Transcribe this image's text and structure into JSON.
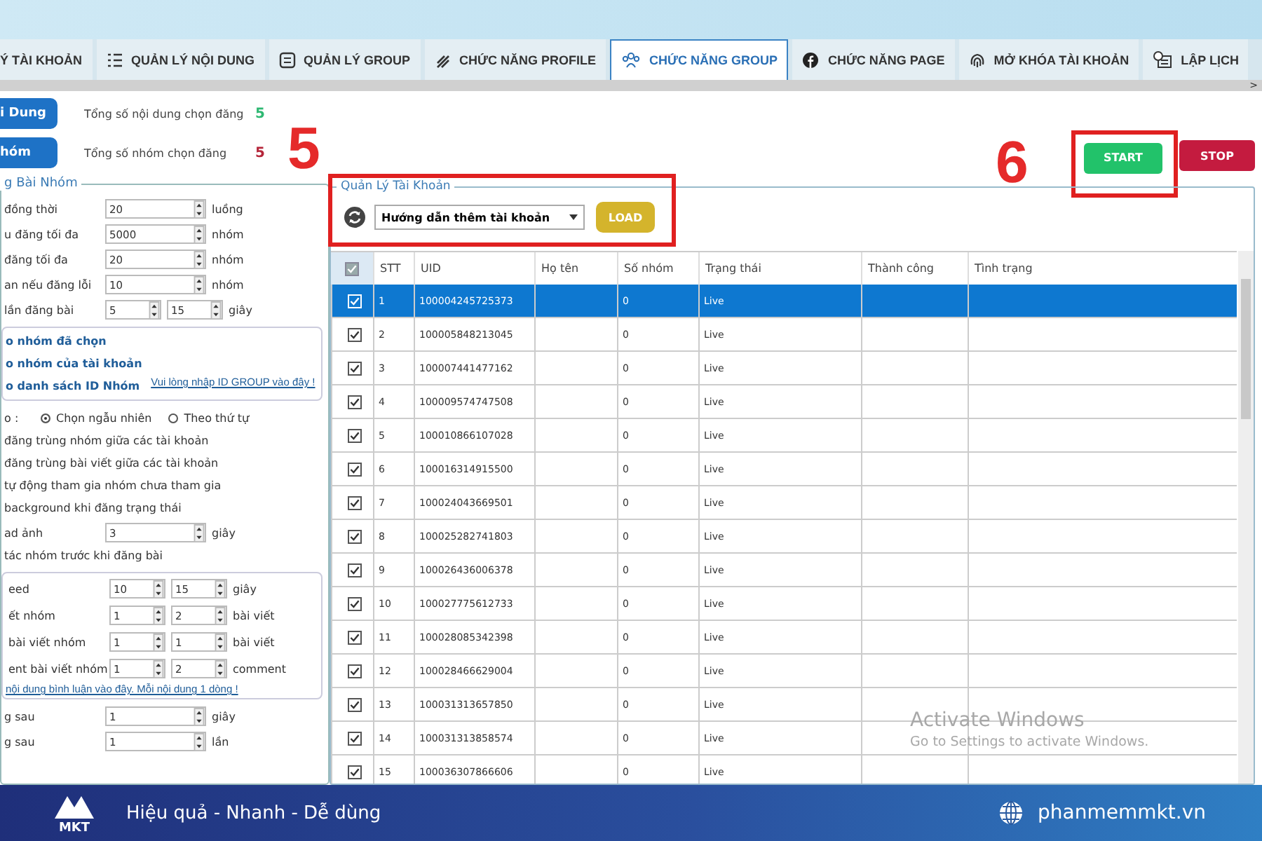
{
  "tabs": [
    {
      "label": "Ý TÀI KHOẢN",
      "selected": false
    },
    {
      "label": "QUẢN LÝ NỘI DUNG",
      "selected": false
    },
    {
      "label": "QUẢN LÝ GROUP",
      "selected": false
    },
    {
      "label": "CHỨC NĂNG PROFILE",
      "selected": false
    },
    {
      "label": "CHỨC NĂNG GROUP",
      "selected": true
    },
    {
      "label": "CHỨC NĂNG PAGE",
      "selected": false
    },
    {
      "label": "MỞ KHÓA TÀI KHOẢN",
      "selected": false
    },
    {
      "label": "LẬP LỊCH",
      "selected": false
    }
  ],
  "tab_scroll": ">",
  "summary": [
    {
      "button": "i Dung",
      "label": "Tổng số nội dung chọn đăng",
      "count": "5",
      "color": "#2eb872"
    },
    {
      "button": "hóm",
      "label": "Tổng số nhóm chọn đăng",
      "count": "5",
      "color": "#b5263a"
    }
  ],
  "annotations": [
    {
      "number": "5"
    },
    {
      "number": "6"
    }
  ],
  "actions": {
    "start": "START",
    "stop": "STOP"
  },
  "settings": {
    "title": "g Bài Nhóm",
    "rows": [
      {
        "kind": "spin",
        "label": "đồng thời",
        "values": [
          "20"
        ],
        "unit": "luồng"
      },
      {
        "kind": "spin",
        "label": "u đăng tối đa",
        "values": [
          "5000"
        ],
        "unit": "nhóm"
      },
      {
        "kind": "spin",
        "label": "đăng tối đa",
        "values": [
          "20"
        ],
        "unit": "nhóm"
      },
      {
        "kind": "spin",
        "label": "an nếu đăng lỗi",
        "values": [
          "10"
        ],
        "unit": "nhóm"
      },
      {
        "kind": "spin",
        "label": "lần đăng bài",
        "values": [
          "5",
          "15"
        ],
        "unit": "giây"
      },
      {
        "kind": "box",
        "items": [
          {
            "kind": "option",
            "label": "o nhóm đã chọn"
          },
          {
            "kind": "option",
            "label": "o nhóm của tài khoản"
          },
          {
            "kind": "option",
            "label": "o danh sách ID Nhóm",
            "link": "Vui lòng nhập ID GROUP vào đây !"
          }
        ]
      },
      {
        "kind": "radio",
        "label": "o :",
        "options": [
          {
            "label": "Chọn ngẫu nhiên",
            "selected": true
          },
          {
            "label": "Theo thứ tự",
            "selected": false
          }
        ]
      },
      {
        "kind": "text",
        "label": "đăng trùng nhóm giữa các tài khoản"
      },
      {
        "kind": "text",
        "label": "đăng trùng bài viết giữa các tài khoản"
      },
      {
        "kind": "text",
        "label": "tự động tham gia nhóm chưa tham gia"
      },
      {
        "kind": "text",
        "label": "background khi đăng trạng thái"
      },
      {
        "kind": "spin",
        "label": "ad ảnh",
        "values": [
          "3"
        ],
        "unit": "giây"
      },
      {
        "kind": "text",
        "label": "tác nhóm trước khi đăng bài"
      },
      {
        "kind": "box",
        "items": [
          {
            "kind": "spin",
            "label": "eed",
            "values": [
              "10",
              "15"
            ],
            "unit": "giây"
          },
          {
            "kind": "spin",
            "label": "ết nhóm",
            "values": [
              "1",
              "2"
            ],
            "unit": "bài viết"
          },
          {
            "kind": "spin",
            "label": "bài viết nhóm",
            "values": [
              "1",
              "1"
            ],
            "unit": "bài viết"
          },
          {
            "kind": "spin",
            "label": "ent bài viết nhóm",
            "values": [
              "1",
              "2"
            ],
            "unit": "comment"
          },
          {
            "kind": "link",
            "label": "nội dung bình luận vào đây. Mỗi nội dung 1 dòng !"
          }
        ]
      },
      {
        "kind": "spin",
        "label": "g sau",
        "values": [
          "1"
        ],
        "unit": "giây"
      },
      {
        "kind": "spin",
        "label": "g sau",
        "values": [
          "1"
        ],
        "unit": "lần"
      }
    ]
  },
  "accounts": {
    "title": "Quản Lý Tài Khoản",
    "dropdown": "Hướng dẫn thêm tài khoản",
    "load": "LOAD",
    "table": {
      "all_checked": true,
      "columns": [
        "STT",
        "UID",
        "Họ tên",
        "Số nhóm",
        "Trạng thái",
        "Thành công",
        "Tình trạng"
      ],
      "rows": [
        {
          "checked": true,
          "selected": true,
          "cells": [
            "1",
            "100004245725373",
            "",
            "0",
            "Live",
            "",
            ""
          ]
        },
        {
          "checked": true,
          "selected": false,
          "cells": [
            "2",
            "100005848213045",
            "",
            "0",
            "Live",
            "",
            ""
          ]
        },
        {
          "checked": true,
          "selected": false,
          "cells": [
            "3",
            "100007441477162",
            "",
            "0",
            "Live",
            "",
            ""
          ]
        },
        {
          "checked": true,
          "selected": false,
          "cells": [
            "4",
            "100009574747508",
            "",
            "0",
            "Live",
            "",
            ""
          ]
        },
        {
          "checked": true,
          "selected": false,
          "cells": [
            "5",
            "100010866107028",
            "",
            "0",
            "Live",
            "",
            ""
          ]
        },
        {
          "checked": true,
          "selected": false,
          "cells": [
            "6",
            "100016314915500",
            "",
            "0",
            "Live",
            "",
            ""
          ]
        },
        {
          "checked": true,
          "selected": false,
          "cells": [
            "7",
            "100024043669501",
            "",
            "0",
            "Live",
            "",
            ""
          ]
        },
        {
          "checked": true,
          "selected": false,
          "cells": [
            "8",
            "100025282741803",
            "",
            "0",
            "Live",
            "",
            ""
          ]
        },
        {
          "checked": true,
          "selected": false,
          "cells": [
            "9",
            "100026436006378",
            "",
            "0",
            "Live",
            "",
            ""
          ]
        },
        {
          "checked": true,
          "selected": false,
          "cells": [
            "10",
            "100027775612733",
            "",
            "0",
            "Live",
            "",
            ""
          ]
        },
        {
          "checked": true,
          "selected": false,
          "cells": [
            "11",
            "100028085342398",
            "",
            "0",
            "Live",
            "",
            ""
          ]
        },
        {
          "checked": true,
          "selected": false,
          "cells": [
            "12",
            "100028466629004",
            "",
            "0",
            "Live",
            "",
            ""
          ]
        },
        {
          "checked": true,
          "selected": false,
          "cells": [
            "13",
            "100031313657850",
            "",
            "0",
            "Live",
            "",
            ""
          ]
        },
        {
          "checked": true,
          "selected": false,
          "cells": [
            "14",
            "100031313858574",
            "",
            "0",
            "Live",
            "",
            ""
          ]
        },
        {
          "checked": true,
          "selected": false,
          "cells": [
            "15",
            "100036307866606",
            "",
            "0",
            "Live",
            "",
            ""
          ]
        }
      ]
    }
  },
  "os_notice": {
    "title": "Activate Windows",
    "subtitle": "Go to Settings to activate Windows."
  },
  "banner": {
    "logo": "MKT",
    "slogan": "Hiệu quả - Nhanh - Dễ dùng",
    "website": "phanmemmkt.vn"
  }
}
